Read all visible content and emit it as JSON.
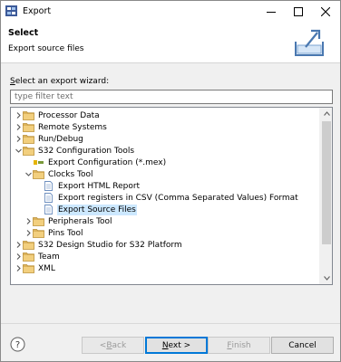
{
  "window": {
    "title": "Export"
  },
  "banner": {
    "title": "Select",
    "description": "Export source files"
  },
  "wizard": {
    "label_mnemonic": "S",
    "label_rest": "elect an export wizard:",
    "filter_placeholder": "type filter text",
    "tree": [
      {
        "label": "Processor Data",
        "icon": "folder-icon",
        "expanded": false,
        "level": 0
      },
      {
        "label": "Remote Systems",
        "icon": "folder-icon",
        "expanded": false,
        "level": 0
      },
      {
        "label": "Run/Debug",
        "icon": "folder-icon",
        "expanded": false,
        "level": 0
      },
      {
        "label": "S32 Configuration Tools",
        "icon": "folder-icon",
        "expanded": true,
        "level": 0
      },
      {
        "label": "Export Configuration (*.mex)",
        "icon": "mex-export-icon",
        "expanded": null,
        "level": 1
      },
      {
        "label": "Clocks Tool",
        "icon": "folder-icon",
        "expanded": true,
        "level": 1
      },
      {
        "label": "Export HTML Report",
        "icon": "document-icon",
        "expanded": null,
        "level": 2
      },
      {
        "label": "Export registers in CSV (Comma Separated Values) Format",
        "icon": "document-icon",
        "expanded": null,
        "level": 2
      },
      {
        "label": "Export Source Files",
        "icon": "document-icon",
        "expanded": null,
        "level": 2,
        "selected": true
      },
      {
        "label": "Peripherals Tool",
        "icon": "folder-icon",
        "expanded": false,
        "level": 1
      },
      {
        "label": "Pins Tool",
        "icon": "folder-icon",
        "expanded": false,
        "level": 1
      },
      {
        "label": "S32 Design Studio for S32 Platform",
        "icon": "folder-icon",
        "expanded": false,
        "level": 0
      },
      {
        "label": "Team",
        "icon": "folder-icon",
        "expanded": false,
        "level": 0
      },
      {
        "label": "XML",
        "icon": "folder-icon",
        "expanded": false,
        "level": 0
      }
    ]
  },
  "buttons": {
    "back_mnemonic": "B",
    "back_prefix": "< ",
    "back_rest": "ack",
    "next_mnemonic": "N",
    "next_rest": "ext >",
    "finish_mnemonic": "F",
    "finish_rest": "inish",
    "cancel": "Cancel"
  },
  "colors": {
    "selection": "#cce8ff",
    "folder": "#dcb35c",
    "default_button_border": "#0078d7"
  }
}
